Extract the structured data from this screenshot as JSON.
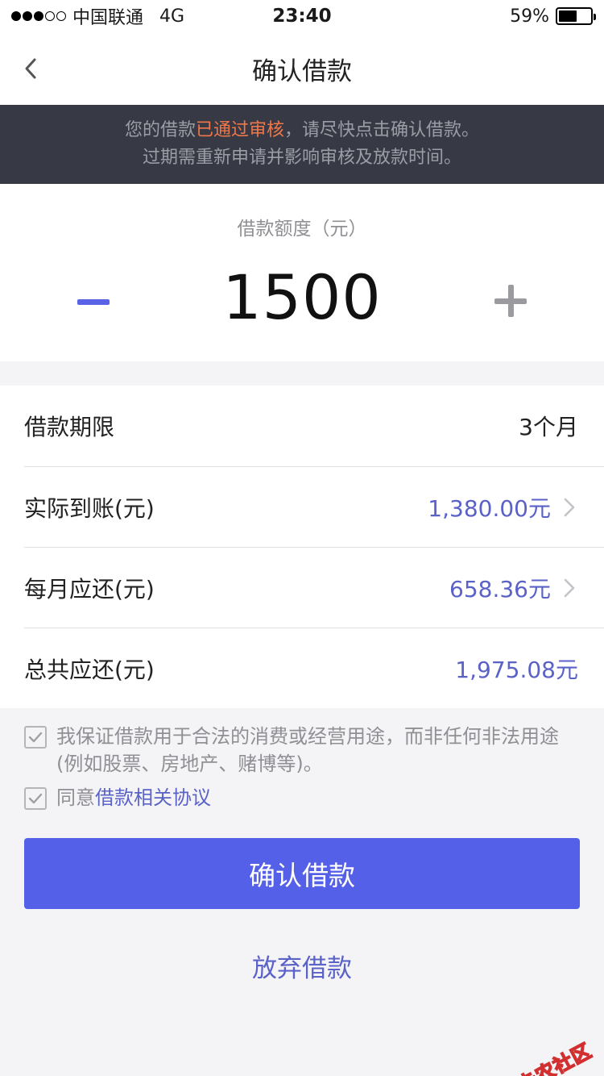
{
  "status_bar": {
    "carrier": "中国联通",
    "network": "4G",
    "time": "23:40",
    "battery": "59%",
    "battery_level": 0.59
  },
  "nav": {
    "title": "确认借款"
  },
  "notice": {
    "line1_before": "您的借款",
    "line1_highlight": "已通过审核",
    "line1_after": "，请尽快点击确认借款。",
    "line2": "过期需重新申请并影响审核及放款时间。"
  },
  "amount": {
    "label": "借款额度（元）",
    "value": "1500"
  },
  "details": [
    {
      "label": "借款期限",
      "value": "3个月",
      "highlight": false,
      "arrow": false
    },
    {
      "label": "实际到账(元)",
      "value": "1,380.00元",
      "highlight": true,
      "arrow": true
    },
    {
      "label": "每月应还(元)",
      "value": "658.36元",
      "highlight": true,
      "arrow": true
    },
    {
      "label": "总共应还(元)",
      "value": "1,975.08元",
      "highlight": true,
      "arrow": false
    }
  ],
  "agreements": {
    "guarantee": "我保证借款用于合法的消费或经营用途，而非任何非法用途(例如股票、房地产、赌博等)。",
    "agree_prefix": "同意",
    "agree_link": "借款相关协议"
  },
  "buttons": {
    "confirm": "确认借款",
    "abandon": "放弃借款"
  },
  "watermark": {
    "text": "卡农社区"
  },
  "colors": {
    "accent": "#5560e8",
    "link": "#5a62c8",
    "highlight": "#f0774a",
    "notice_bg": "#373a45"
  }
}
